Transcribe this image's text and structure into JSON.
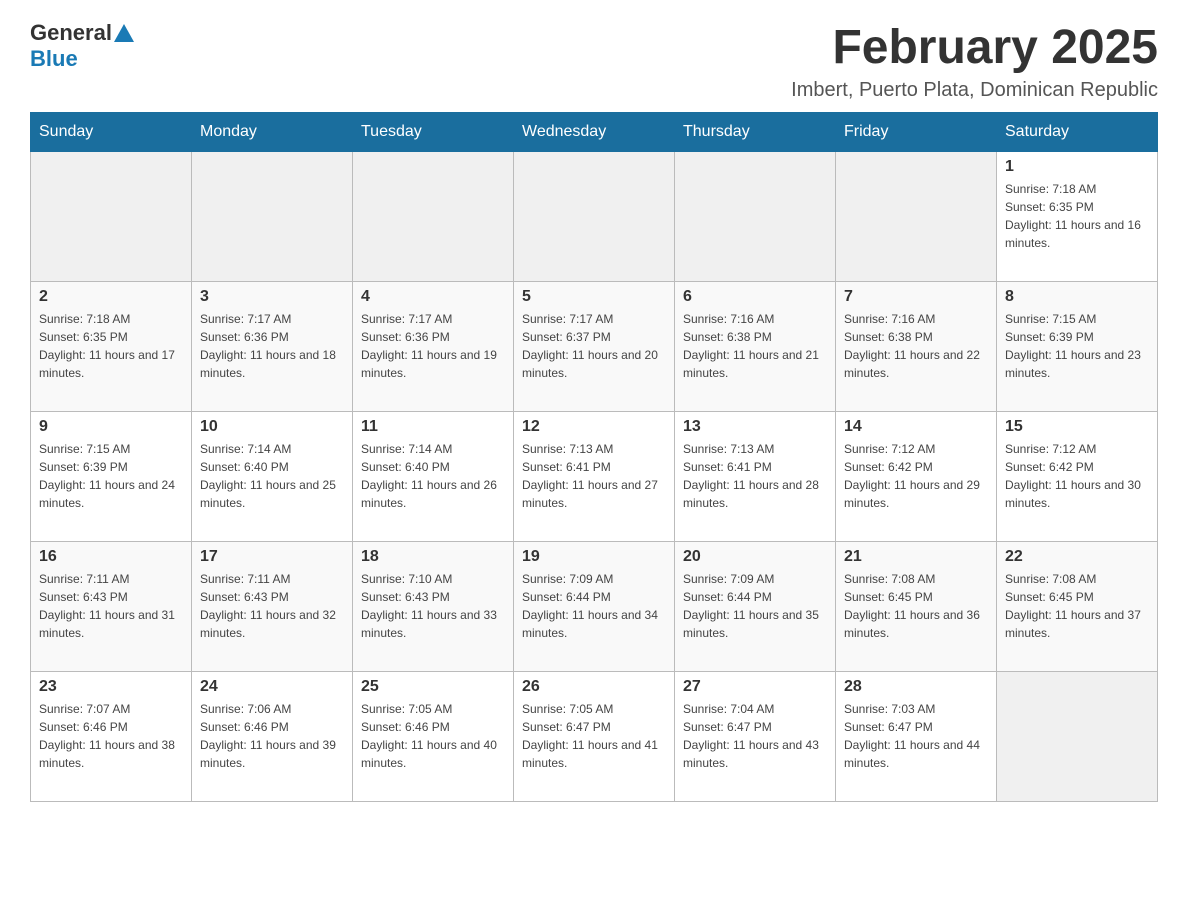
{
  "header": {
    "logo": {
      "general": "General",
      "blue": "Blue"
    },
    "title": "February 2025",
    "location": "Imbert, Puerto Plata, Dominican Republic"
  },
  "calendar": {
    "days_of_week": [
      "Sunday",
      "Monday",
      "Tuesday",
      "Wednesday",
      "Thursday",
      "Friday",
      "Saturday"
    ],
    "weeks": [
      [
        {
          "day": "",
          "info": ""
        },
        {
          "day": "",
          "info": ""
        },
        {
          "day": "",
          "info": ""
        },
        {
          "day": "",
          "info": ""
        },
        {
          "day": "",
          "info": ""
        },
        {
          "day": "",
          "info": ""
        },
        {
          "day": "1",
          "info": "Sunrise: 7:18 AM\nSunset: 6:35 PM\nDaylight: 11 hours and 16 minutes."
        }
      ],
      [
        {
          "day": "2",
          "info": "Sunrise: 7:18 AM\nSunset: 6:35 PM\nDaylight: 11 hours and 17 minutes."
        },
        {
          "day": "3",
          "info": "Sunrise: 7:17 AM\nSunset: 6:36 PM\nDaylight: 11 hours and 18 minutes."
        },
        {
          "day": "4",
          "info": "Sunrise: 7:17 AM\nSunset: 6:36 PM\nDaylight: 11 hours and 19 minutes."
        },
        {
          "day": "5",
          "info": "Sunrise: 7:17 AM\nSunset: 6:37 PM\nDaylight: 11 hours and 20 minutes."
        },
        {
          "day": "6",
          "info": "Sunrise: 7:16 AM\nSunset: 6:38 PM\nDaylight: 11 hours and 21 minutes."
        },
        {
          "day": "7",
          "info": "Sunrise: 7:16 AM\nSunset: 6:38 PM\nDaylight: 11 hours and 22 minutes."
        },
        {
          "day": "8",
          "info": "Sunrise: 7:15 AM\nSunset: 6:39 PM\nDaylight: 11 hours and 23 minutes."
        }
      ],
      [
        {
          "day": "9",
          "info": "Sunrise: 7:15 AM\nSunset: 6:39 PM\nDaylight: 11 hours and 24 minutes."
        },
        {
          "day": "10",
          "info": "Sunrise: 7:14 AM\nSunset: 6:40 PM\nDaylight: 11 hours and 25 minutes."
        },
        {
          "day": "11",
          "info": "Sunrise: 7:14 AM\nSunset: 6:40 PM\nDaylight: 11 hours and 26 minutes."
        },
        {
          "day": "12",
          "info": "Sunrise: 7:13 AM\nSunset: 6:41 PM\nDaylight: 11 hours and 27 minutes."
        },
        {
          "day": "13",
          "info": "Sunrise: 7:13 AM\nSunset: 6:41 PM\nDaylight: 11 hours and 28 minutes."
        },
        {
          "day": "14",
          "info": "Sunrise: 7:12 AM\nSunset: 6:42 PM\nDaylight: 11 hours and 29 minutes."
        },
        {
          "day": "15",
          "info": "Sunrise: 7:12 AM\nSunset: 6:42 PM\nDaylight: 11 hours and 30 minutes."
        }
      ],
      [
        {
          "day": "16",
          "info": "Sunrise: 7:11 AM\nSunset: 6:43 PM\nDaylight: 11 hours and 31 minutes."
        },
        {
          "day": "17",
          "info": "Sunrise: 7:11 AM\nSunset: 6:43 PM\nDaylight: 11 hours and 32 minutes."
        },
        {
          "day": "18",
          "info": "Sunrise: 7:10 AM\nSunset: 6:43 PM\nDaylight: 11 hours and 33 minutes."
        },
        {
          "day": "19",
          "info": "Sunrise: 7:09 AM\nSunset: 6:44 PM\nDaylight: 11 hours and 34 minutes."
        },
        {
          "day": "20",
          "info": "Sunrise: 7:09 AM\nSunset: 6:44 PM\nDaylight: 11 hours and 35 minutes."
        },
        {
          "day": "21",
          "info": "Sunrise: 7:08 AM\nSunset: 6:45 PM\nDaylight: 11 hours and 36 minutes."
        },
        {
          "day": "22",
          "info": "Sunrise: 7:08 AM\nSunset: 6:45 PM\nDaylight: 11 hours and 37 minutes."
        }
      ],
      [
        {
          "day": "23",
          "info": "Sunrise: 7:07 AM\nSunset: 6:46 PM\nDaylight: 11 hours and 38 minutes."
        },
        {
          "day": "24",
          "info": "Sunrise: 7:06 AM\nSunset: 6:46 PM\nDaylight: 11 hours and 39 minutes."
        },
        {
          "day": "25",
          "info": "Sunrise: 7:05 AM\nSunset: 6:46 PM\nDaylight: 11 hours and 40 minutes."
        },
        {
          "day": "26",
          "info": "Sunrise: 7:05 AM\nSunset: 6:47 PM\nDaylight: 11 hours and 41 minutes."
        },
        {
          "day": "27",
          "info": "Sunrise: 7:04 AM\nSunset: 6:47 PM\nDaylight: 11 hours and 43 minutes."
        },
        {
          "day": "28",
          "info": "Sunrise: 7:03 AM\nSunset: 6:47 PM\nDaylight: 11 hours and 44 minutes."
        },
        {
          "day": "",
          "info": ""
        }
      ]
    ]
  }
}
